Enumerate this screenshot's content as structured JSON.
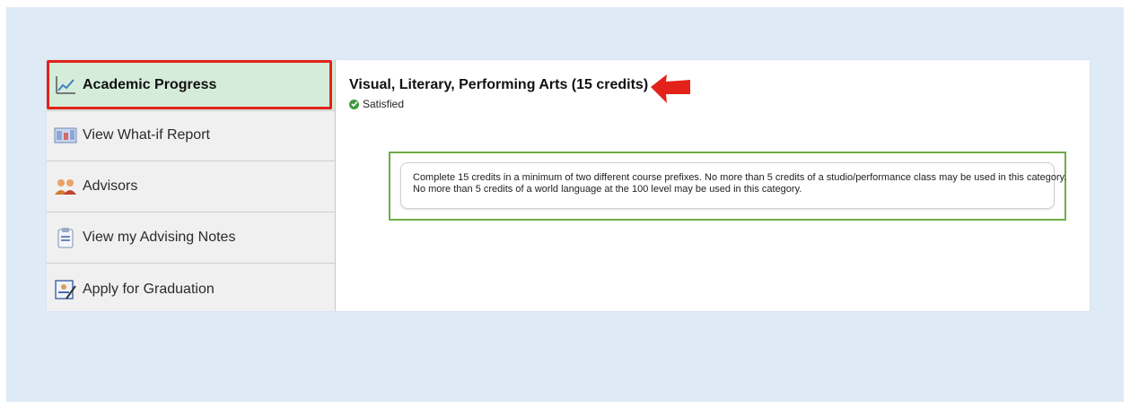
{
  "sidebar": {
    "items": [
      {
        "label": "Academic Progress",
        "icon": "chart-line-icon",
        "active": true
      },
      {
        "label": "View What-if Report",
        "icon": "report-icon"
      },
      {
        "label": "Advisors",
        "icon": "people-icon"
      },
      {
        "label": "View my Advising Notes",
        "icon": "clipboard-icon"
      },
      {
        "label": "Apply for Graduation",
        "icon": "diploma-icon"
      }
    ]
  },
  "requirement": {
    "title": "Visual, Literary, Performing Arts (15 credits)",
    "status": "Satisfied",
    "description_line1": "Complete 15 credits in a minimum of two different course prefixes. No more than 5 credits of a studio/performance class may be used in this category.",
    "description_line2": "No more than 5 credits of a world language at the 100 level may be used in this category."
  },
  "colors": {
    "highlight_red": "#e32219",
    "highlight_green": "#70ad47",
    "active_bg": "#d4ecd9",
    "satisfied_green": "#3f9b3f",
    "backdrop": "#deeaf6"
  }
}
